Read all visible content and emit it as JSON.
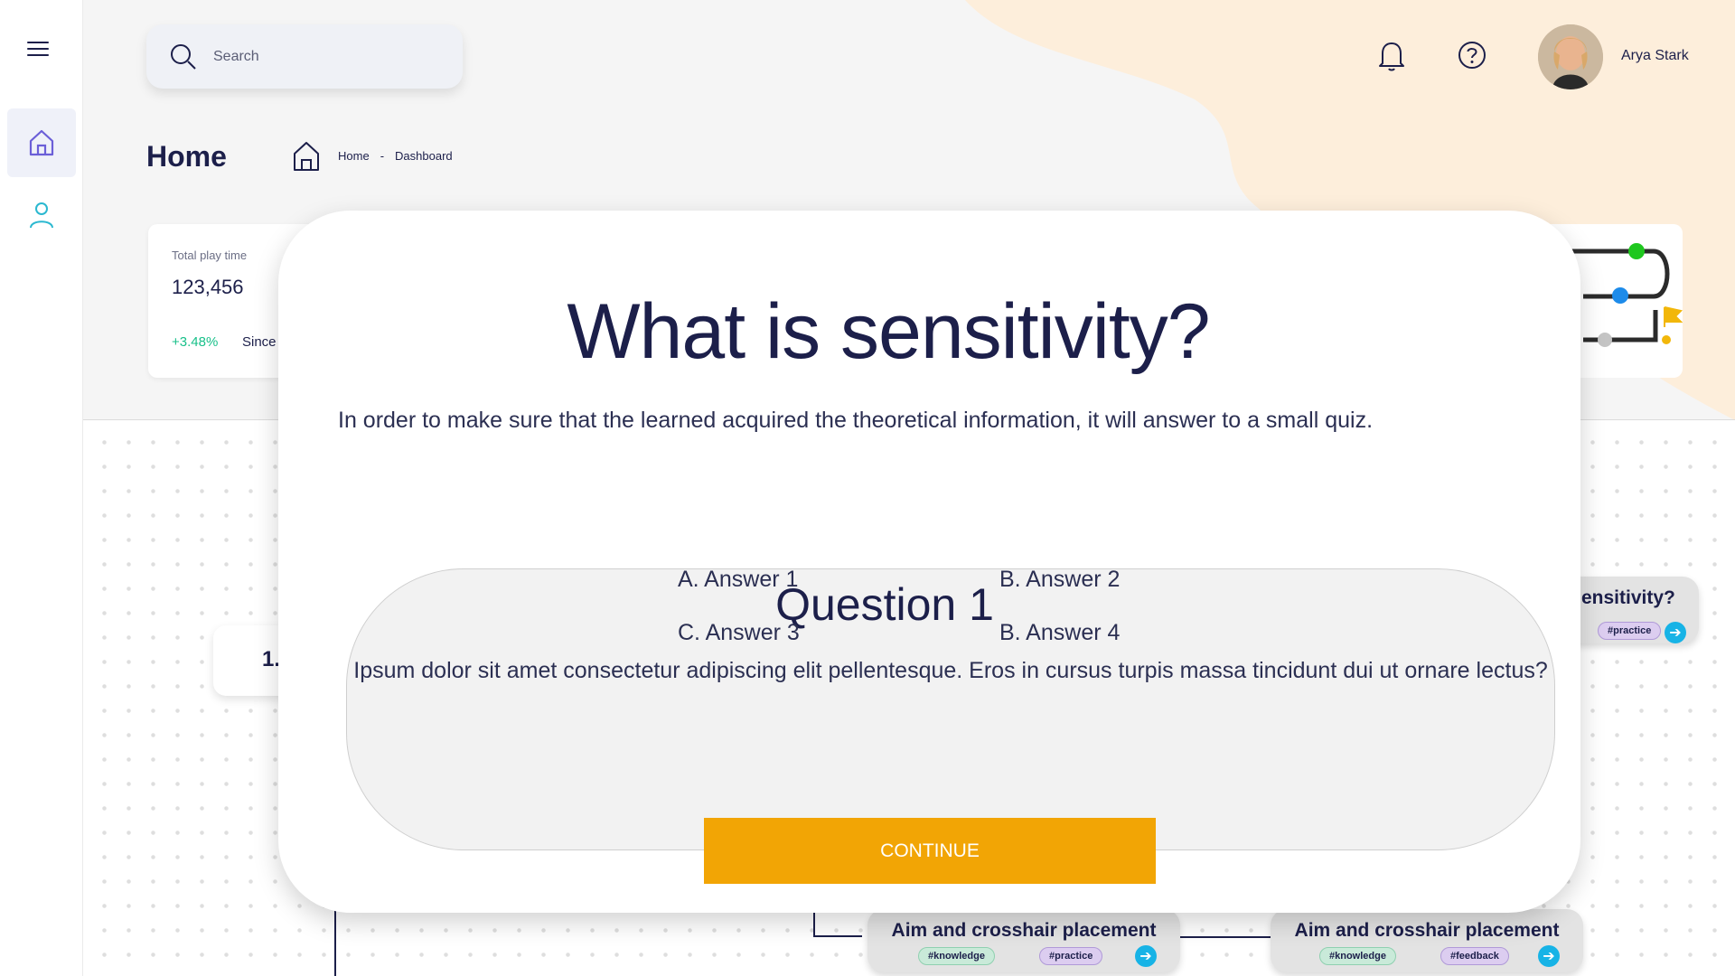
{
  "header": {
    "search_placeholder": "Search",
    "username": "Arya Stark"
  },
  "page": {
    "title": "Home",
    "breadcrumb": [
      "Home",
      "-",
      "Dashboard"
    ]
  },
  "stat_card": {
    "label": "Total play time",
    "value": "123,456",
    "change": "+3.48%",
    "since": "Since"
  },
  "cards": {
    "node1_label": "1.",
    "card_right_title": "ensitivity?",
    "card_right_tag": "#practice",
    "card_bottom1_title": "Aim and crosshair placement",
    "card_bottom1_tags": [
      "#knowledge",
      "#practice"
    ],
    "card_bottom2_title": "Aim and crosshair placement",
    "card_bottom2_tags": [
      "#knowledge",
      "#feedback"
    ],
    "go_glyph": "➔"
  },
  "modal": {
    "title": "What is sensitivity?",
    "description": "In order to make sure that the learned acquired the theoretical information, it will answer to a small quiz.",
    "quiz": {
      "title": "Question 1",
      "question": "Ipsum dolor sit amet consectetur adipiscing elit pellentesque. Eros in cursus turpis massa tincidunt dui ut ornare lectus?",
      "answers": [
        "A. Answer 1",
        "B. Answer 2",
        "C. Answer 3",
        "B. Answer 4"
      ]
    },
    "continue_label": "CONTINUE"
  },
  "colors": {
    "accent": "#f2a505",
    "text_primary": "#1c1f4a",
    "positive": "#19c08a",
    "peach": "#fdeedb",
    "link_blue": "#17b3e6"
  },
  "icons": [
    "menu-icon",
    "home-icon",
    "user-icon",
    "search-icon",
    "bell-icon",
    "help-icon",
    "arrow-right-icon",
    "flag-icon"
  ]
}
